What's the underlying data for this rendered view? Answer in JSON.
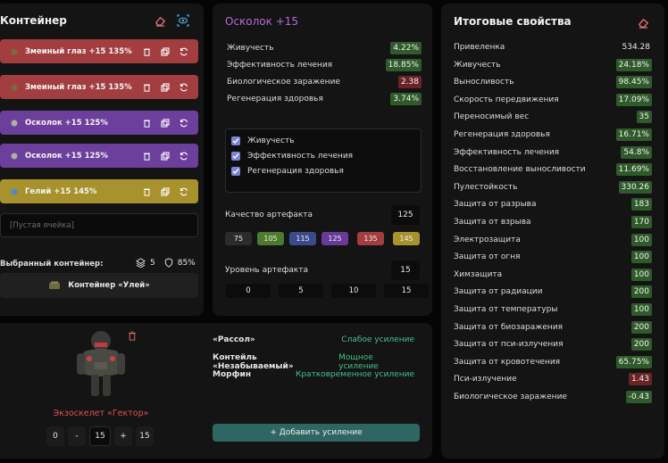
{
  "container": {
    "title": "Контейнер",
    "slots": [
      {
        "name": "Змеиный глаз +15 135%",
        "color": "red"
      },
      {
        "name": "Змеиный глаз +15 135%",
        "color": "red"
      },
      {
        "name": "Осколок +15 125%",
        "color": "purple"
      },
      {
        "name": "Осколок +15 125%",
        "color": "purple"
      },
      {
        "name": "Гелий +15 145%",
        "color": "yellow"
      }
    ],
    "empty_slot": "[Пустая ячейка]",
    "selected_label": "Выбранный контейнер:",
    "stack_count": "5",
    "protection": "85%",
    "container_name": "Контейнер «Улей»"
  },
  "artifact": {
    "title": "Осколок +15",
    "stats": [
      {
        "name": "Живучесть",
        "value": "4.22%",
        "tone": "green"
      },
      {
        "name": "Эффективность лечения",
        "value": "18.85%",
        "tone": "green"
      },
      {
        "name": "Биологическое заражение",
        "value": "2.38",
        "tone": "red"
      },
      {
        "name": "Регенерация здоровья",
        "value": "3.74%",
        "tone": "green"
      }
    ],
    "checks": [
      "Живучесть",
      "Эффективность лечения",
      "Регенерация здоровья"
    ],
    "quality_label": "Качество артефакта",
    "quality_value": "125",
    "quality_options": [
      "75",
      "105",
      "115",
      "125",
      "135",
      "145"
    ],
    "level_label": "Уровень артефакта",
    "level_value": "15",
    "level_options": [
      "0",
      "5",
      "10",
      "15"
    ]
  },
  "suit": {
    "name": "Экзоскелет «Гектор»",
    "stepper": {
      "min": "0",
      "minus": "-",
      "value": "15",
      "plus": "+",
      "max": "15"
    },
    "boosts": [
      {
        "name": "«Рассол»",
        "value": "Слабое усиление"
      },
      {
        "name": "Контейль «Незабываемый»",
        "value": "Мощное усиление"
      },
      {
        "name": "Морфин",
        "value": "Кратковременное усиление"
      }
    ],
    "add_boost": "+ Добавить усиление"
  },
  "totals": {
    "title": "Итоговые свойства",
    "rows": [
      {
        "name": "Привеленка",
        "value": "534.28",
        "tone": "plain"
      },
      {
        "name": "Живучесть",
        "value": "24.18%",
        "tone": "green"
      },
      {
        "name": "Выносливость",
        "value": "98.45%",
        "tone": "green"
      },
      {
        "name": "Скорость передвижения",
        "value": "17.09%",
        "tone": "green"
      },
      {
        "name": "Переносимый вес",
        "value": "35",
        "tone": "green"
      },
      {
        "name": "Регенерация здоровья",
        "value": "16.71%",
        "tone": "green"
      },
      {
        "name": "Эффективность лечения",
        "value": "54.8%",
        "tone": "green"
      },
      {
        "name": "Восстановление выносливости",
        "value": "11.69%",
        "tone": "green"
      },
      {
        "name": "Пулестойкость",
        "value": "330.26",
        "tone": "green"
      },
      {
        "name": "Защита от разрыва",
        "value": "183",
        "tone": "green"
      },
      {
        "name": "Защита от взрыва",
        "value": "170",
        "tone": "green"
      },
      {
        "name": "Электрозащита",
        "value": "100",
        "tone": "green"
      },
      {
        "name": "Защита от огня",
        "value": "100",
        "tone": "green"
      },
      {
        "name": "Химзащита",
        "value": "100",
        "tone": "green"
      },
      {
        "name": "Защита от радиации",
        "value": "200",
        "tone": "green"
      },
      {
        "name": "Защита от температуры",
        "value": "100",
        "tone": "green"
      },
      {
        "name": "Защита от биозаражения",
        "value": "200",
        "tone": "green"
      },
      {
        "name": "Защита от пси-излучения",
        "value": "200",
        "tone": "green"
      },
      {
        "name": "Защита от кровотечения",
        "value": "65.75%",
        "tone": "green"
      },
      {
        "name": "Пси-излучение",
        "value": "1.43",
        "tone": "red"
      },
      {
        "name": "Биологическое заражение",
        "value": "-0.43",
        "tone": "green"
      }
    ]
  }
}
